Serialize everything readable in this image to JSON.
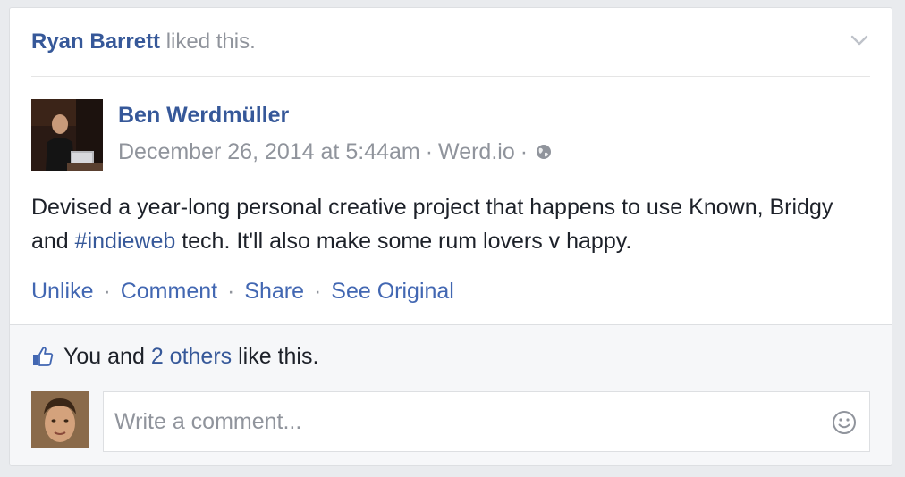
{
  "story": {
    "liker_name": "Ryan Barrett",
    "liked_text": "liked this.",
    "icons": {
      "menu": "chevron-down-icon",
      "audience": "globe-icon"
    }
  },
  "post": {
    "author": "Ben Werdmüller",
    "timestamp": "December 26, 2014 at 5:44am",
    "source": "Werd.io",
    "meta_sep1": " · ",
    "meta_sep2": " · ",
    "text_before": "Devised a year-long personal creative project that happens to use Known, Bridgy and ",
    "hashtag": "#indieweb",
    "text_after": " tech. It'll also make some rum lovers v happy."
  },
  "actions": {
    "unlike": "Unlike",
    "comment": "Comment",
    "share": "Share",
    "see_original": "See Original",
    "sep": "·"
  },
  "likes": {
    "prefix": "You and",
    "others": "2 others",
    "suffix": "like this.",
    "icon": "thumbs-up-icon"
  },
  "comment": {
    "placeholder": "Write a comment...",
    "emoji_icon": "smiley-icon"
  },
  "colors": {
    "link": "#365899",
    "action": "#4267b2",
    "muted": "#90949c",
    "text": "#1d2129",
    "footer_bg": "#f6f7f9"
  }
}
